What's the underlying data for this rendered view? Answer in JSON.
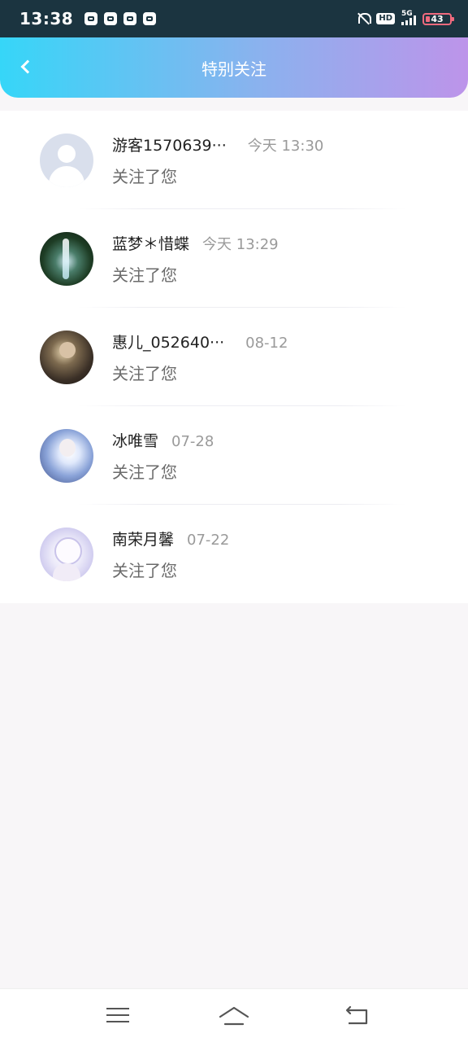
{
  "status_bar": {
    "time": "13:38",
    "hd": "HD",
    "network": "5G",
    "battery": "43"
  },
  "header": {
    "title": "特别关注"
  },
  "items": [
    {
      "name": "游客1570639···",
      "time": "今天 13:30",
      "message": "关注了您",
      "avatar": "default-avatar"
    },
    {
      "name": "蓝梦＊惜蝶",
      "time": "今天 13:29",
      "message": "关注了您",
      "avatar": "waterfall-avatar"
    },
    {
      "name": "惠儿_052640···",
      "time": "08-12",
      "message": "关注了您",
      "avatar": "warrior-avatar"
    },
    {
      "name": "冰唯雪",
      "time": "07-28",
      "message": "关注了您",
      "avatar": "ice-girl-avatar"
    },
    {
      "name": "南荣月馨",
      "time": "07-22",
      "message": "关注了您",
      "avatar": "anime-girl-avatar"
    }
  ]
}
